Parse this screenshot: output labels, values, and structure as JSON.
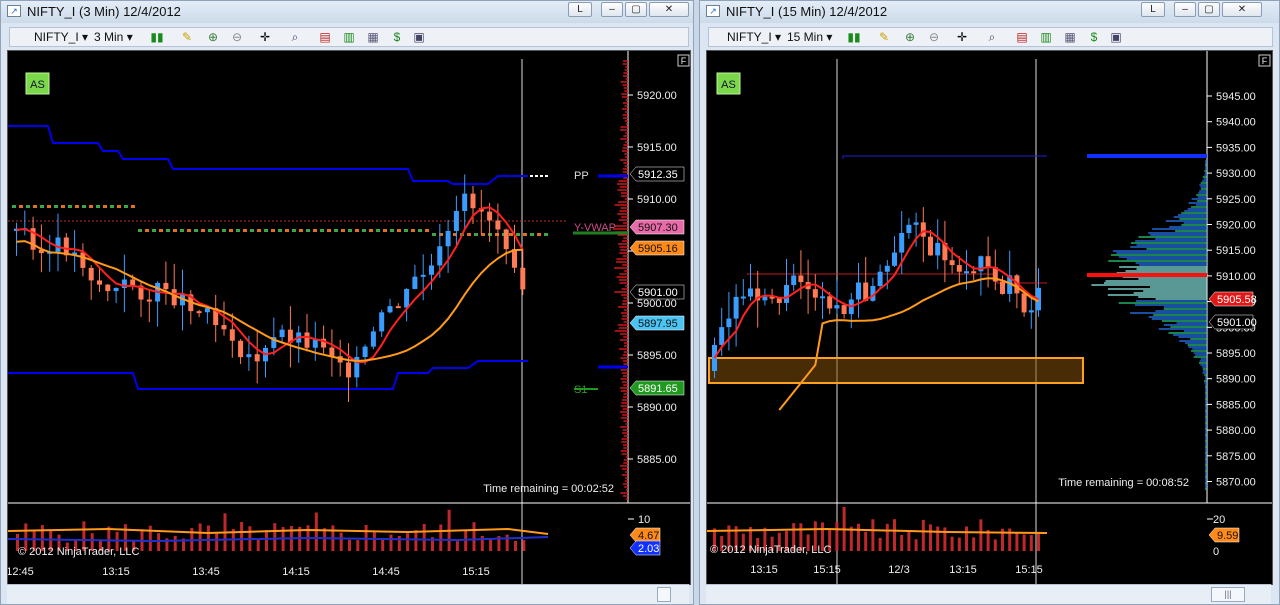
{
  "left": {
    "title": "NIFTY_I (3 Min)  12/4/2012",
    "instrument": "NIFTY_I",
    "interval": "3 Min",
    "as_badge": "AS",
    "f_badge": "F",
    "ylabels": [
      "5920.00",
      "5915.00",
      "5910.00",
      "5905.00",
      "5900.00",
      "5895.00",
      "5890.00",
      "5885.00"
    ],
    "levels": {
      "pp": "PP",
      "yvwap": "Y-VWAP",
      "s1": "S1"
    },
    "price_tags": [
      "5912.35",
      "5907.30",
      "5905.16",
      "5901.00",
      "5897.95",
      "5891.65"
    ],
    "time_remaining": "Time remaining = 00:02:52",
    "copyright": "© 2012 NinjaTrader, LLC",
    "vol_labels": [
      "10",
      "4.67",
      "2.03"
    ],
    "xlabels": [
      "12:45",
      "13:15",
      "13:45",
      "14:15",
      "14:45",
      "15:15"
    ]
  },
  "right": {
    "title": "NIFTY_I (15 Min)  12/4/2012",
    "instrument": "NIFTY_I",
    "interval": "15 Min",
    "as_badge": "AS",
    "f_badge": "F",
    "ylabels": [
      "5945.00",
      "5940.00",
      "5935.00",
      "5930.00",
      "5925.00",
      "5920.00",
      "5915.00",
      "5910.00",
      "5905.00",
      "5900.00",
      "5895.00",
      "5890.00",
      "5885.00",
      "5880.00",
      "5875.00",
      "5870.00"
    ],
    "price_tags": [
      "5905.58",
      "5901.00"
    ],
    "time_remaining": "Time remaining = 00:08:52",
    "copyright": "© 2012 NinjaTrader, LLC",
    "vol_labels": [
      "20",
      "9.59",
      "0"
    ],
    "xlabels": [
      "13:15",
      "15:15",
      "12/3",
      "13:15",
      "15:15"
    ]
  },
  "window_buttons": {
    "restore": "L",
    "minimize": "▭",
    "close": "✕"
  },
  "colors": {
    "pivot": "#0000ee",
    "ema_red": "#ff2020",
    "vwap_orange": "#ff9a1a",
    "up_candle": "#3a9cff",
    "down_candle": "#ff7a55",
    "volume_bar": "#c0282a"
  }
}
